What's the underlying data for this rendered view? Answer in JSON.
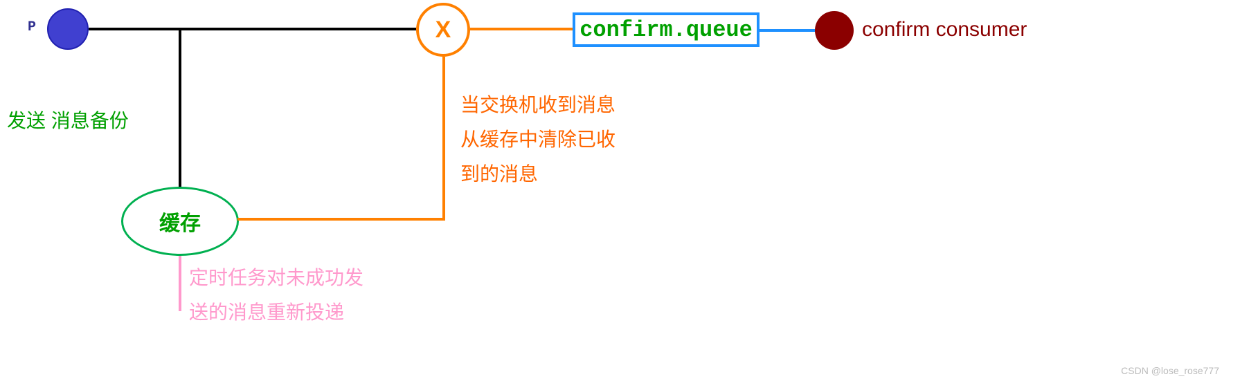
{
  "producer": {
    "label": "P"
  },
  "exchange": {
    "label": "X"
  },
  "queue": {
    "label": "confirm.queue"
  },
  "consumer": {
    "label": "confirm consumer"
  },
  "cache": {
    "label": "缓存"
  },
  "annotations": {
    "backup": "发送 消息备份",
    "clear_line1": "当交换机收到消息",
    "clear_line2": "从缓存中清除已收",
    "clear_line3": "到的消息",
    "retry_line1": "定时任务对未成功发",
    "retry_line2": "送的消息重新投递"
  },
  "watermark": "CSDN @lose_rose777"
}
